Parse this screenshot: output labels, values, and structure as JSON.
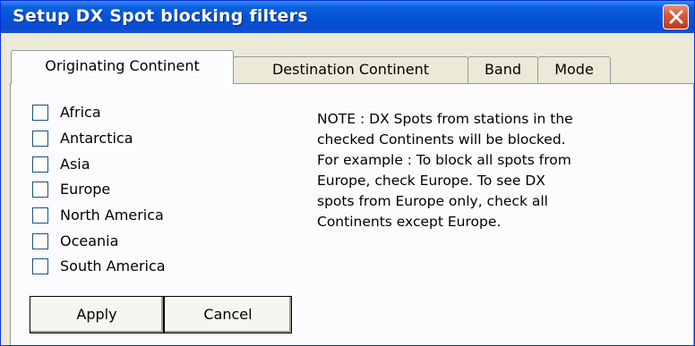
{
  "window": {
    "title": "Setup DX Spot blocking filters"
  },
  "title_bar": {
    "close_icon": "close-x-icon",
    "close_color": "#c7391e"
  },
  "tabs": [
    {
      "label": "Originating Continent",
      "active": true
    },
    {
      "label": "Destination Continent",
      "active": false
    },
    {
      "label": "Band",
      "active": false
    },
    {
      "label": "Mode",
      "active": false
    }
  ],
  "continents": [
    {
      "label": "Africa",
      "checked": false
    },
    {
      "label": "Antarctica",
      "checked": false
    },
    {
      "label": "Asia",
      "checked": false
    },
    {
      "label": "Europe",
      "checked": false
    },
    {
      "label": "North America",
      "checked": false
    },
    {
      "label": "Oceania",
      "checked": false
    },
    {
      "label": "South America",
      "checked": false
    }
  ],
  "note": {
    "lines": [
      "NOTE : DX Spots from stations in the",
      "checked Continents will be blocked.",
      "For example : To block all spots from",
      "Europe, check Europe.  To see DX",
      "spots from Europe only, check all",
      "Continents except Europe."
    ]
  },
  "buttons": {
    "apply": "Apply",
    "cancel": "Cancel"
  }
}
